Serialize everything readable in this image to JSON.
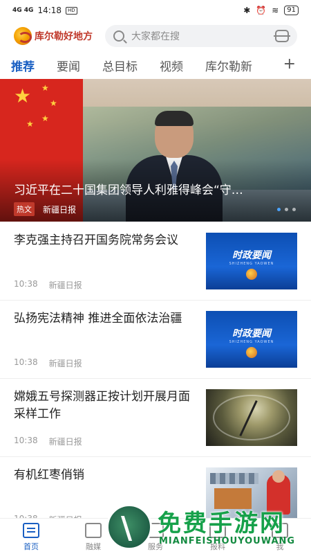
{
  "status_bar": {
    "signal": "4G 4G",
    "time": "14:18",
    "battery": "91"
  },
  "header": {
    "logo_text": "库尔勒好地方",
    "search_placeholder": "大家都在搜"
  },
  "tabs": [
    "推荐",
    "要闻",
    "总目标",
    "视频",
    "库尔勒新"
  ],
  "hero": {
    "title": "习近平在二十国集团领导人利雅得峰会“守…",
    "tag": "热文",
    "source": "新疆日报"
  },
  "news": [
    {
      "title": "李克强主持召开国务院常务会议",
      "time": "10:38",
      "source": "新疆日报",
      "thumb_title": "时政要闻",
      "thumb_sub": "SHIZHENG YAOWEN"
    },
    {
      "title": "弘扬宪法精神 推进全面依法治疆",
      "time": "10:38",
      "source": "新疆日报",
      "thumb_title": "时政要闻",
      "thumb_sub": "SHIZHENG YAOWEN"
    },
    {
      "title": "嫦娥五号探测器正按计划开展月面采样工作",
      "time": "10:38",
      "source": "新疆日报"
    },
    {
      "title": "有机红枣俏销",
      "time": "10:38",
      "source": "新疆日报"
    }
  ],
  "bottom_nav": [
    "首页",
    "融媒",
    "服务",
    "报料",
    "我"
  ],
  "watermark": {
    "text": "免费手游网",
    "sub": "MIANFEISHOUYOUWANG"
  },
  "colors": {
    "accent": "#1a5fc2",
    "brand_red": "#c0392b"
  }
}
